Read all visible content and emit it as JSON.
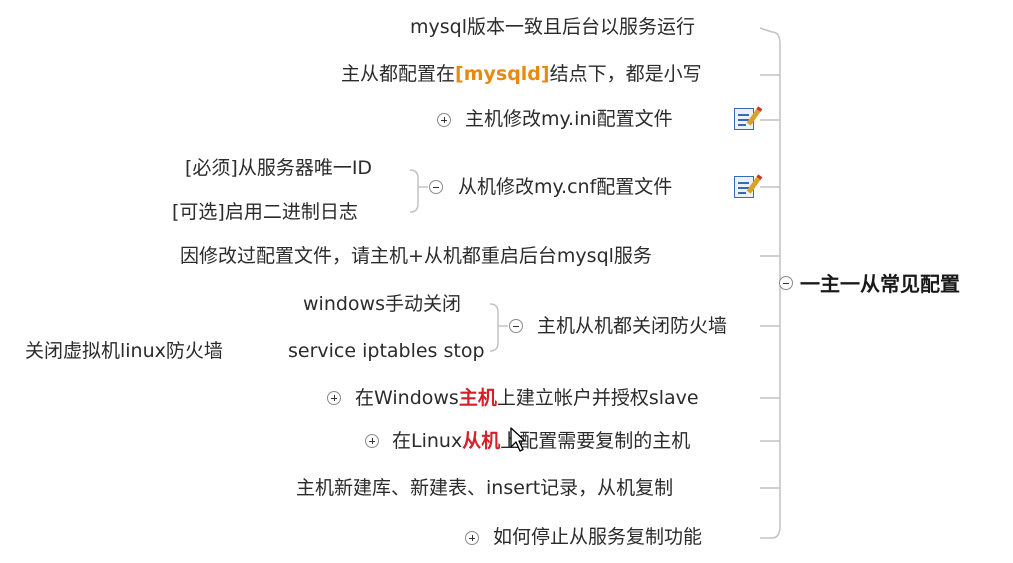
{
  "root": {
    "label": "一主一从常见配置"
  },
  "branches": {
    "b1": {
      "label": "mysql版本一致且后台以服务运行"
    },
    "b2": {
      "pre": "主从都配置在",
      "hl": "[mysqld]",
      "post": "结点下，都是小写"
    },
    "b3": {
      "label": "主机修改my.ini配置文件",
      "icon": "note-icon"
    },
    "b4": {
      "label": "从机修改my.cnf配置文件",
      "icon": "note-icon",
      "children": [
        "[必须]从服务器唯一ID",
        "[可选]启用二进制日志"
      ]
    },
    "b5": {
      "label": "因修改过配置文件，请主机+从机都重启后台mysql服务"
    },
    "b6": {
      "label": "主机从机都关闭防火墙",
      "children": [
        "windows手动关闭",
        "service iptables stop"
      ],
      "grandchild": "关闭虚拟机linux防火墙"
    },
    "b7": {
      "pre": "在Windows",
      "hl": "主机",
      "post": "上建立帐户并授权slave"
    },
    "b8": {
      "pre": "在Linux",
      "hl": "从机",
      "post": "上配置需要复制的主机"
    },
    "b9": {
      "label": "主机新建库、新建表、insert记录，从机复制"
    },
    "b10": {
      "label": "如何停止从服务复制功能"
    }
  },
  "colors": {
    "line": "#bdbdbd",
    "orange": "#e88a12",
    "red": "#d3212c"
  }
}
